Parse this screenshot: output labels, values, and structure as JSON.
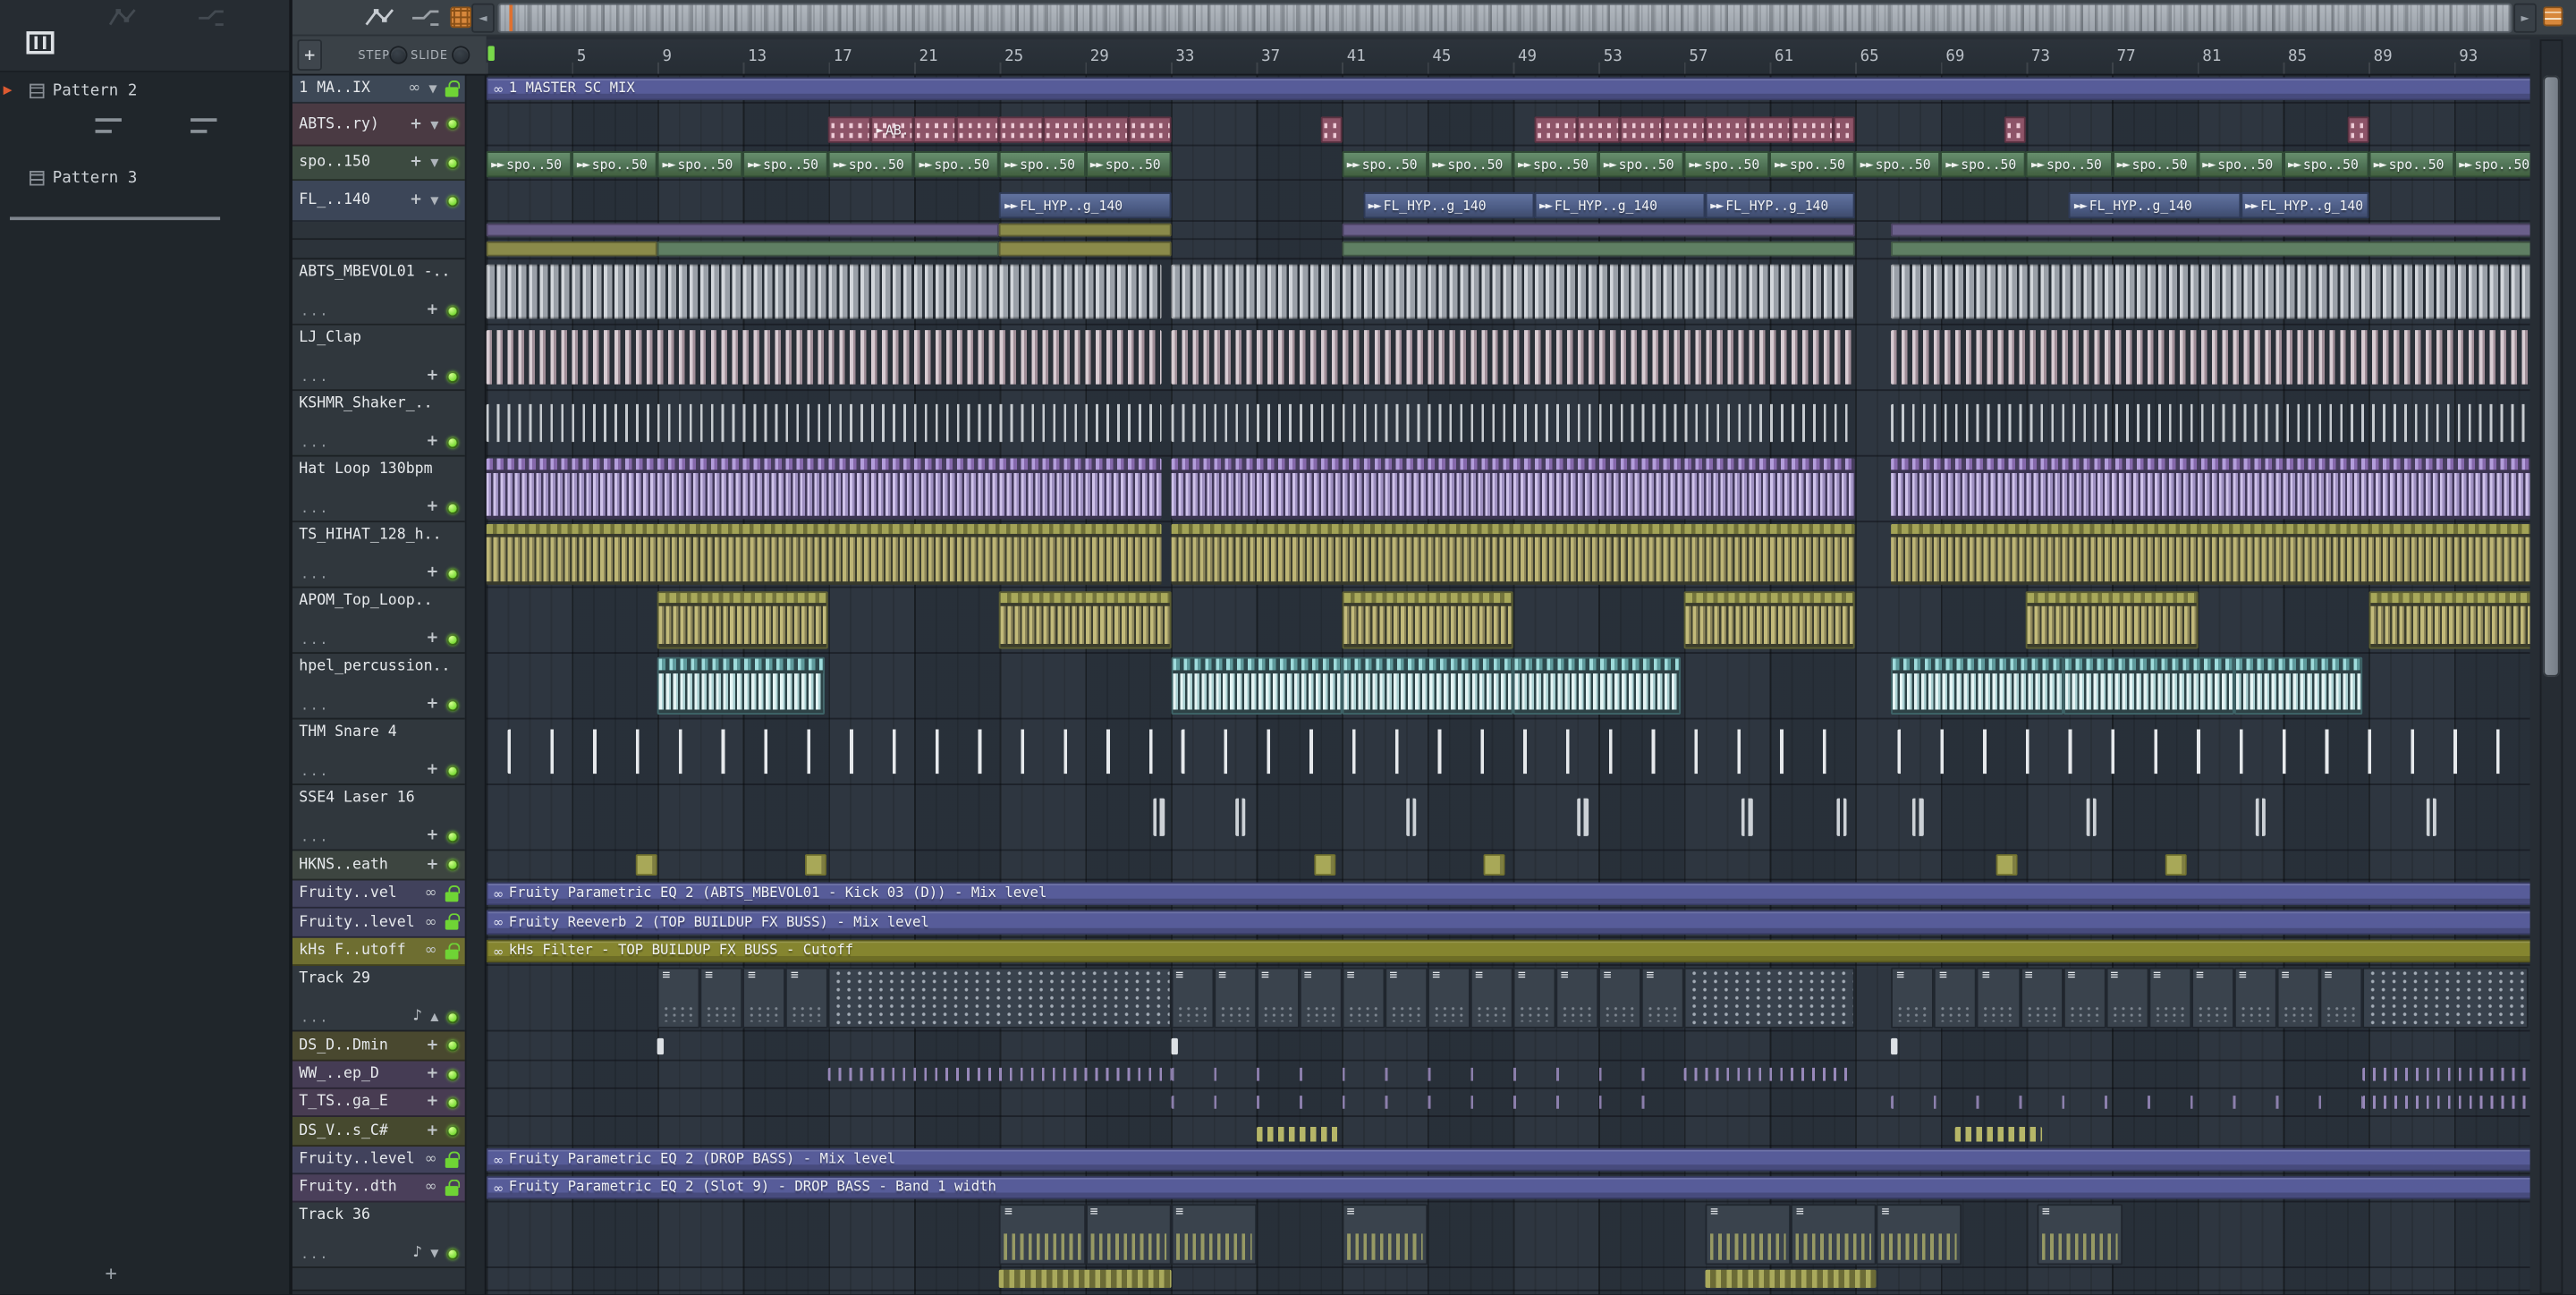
{
  "app": {
    "window": "FL Studio Playlist"
  },
  "colors": {
    "auto_purple": "#575c99",
    "auto_olive": "#85852f",
    "led_green": "#7edc3a",
    "lock_green": "#6fd435",
    "accent_orange": "#d8883c",
    "clip_pink": "#8d5468",
    "clip_green": "#5d8262",
    "clip_blue": "#5a6d99"
  },
  "picker": {
    "patterns": [
      {
        "label": "Pattern 2"
      },
      {
        "label": "Pattern 3"
      }
    ],
    "add_label": "+"
  },
  "toolbar": {
    "add_label": "+",
    "step_label": "STEP",
    "slide_label": "SLIDE"
  },
  "timeline": {
    "numbers": [
      5,
      9,
      13,
      17,
      21,
      25,
      29,
      33,
      37,
      41,
      45,
      49,
      53,
      57,
      61,
      65,
      69,
      73,
      77,
      81,
      85,
      89,
      93
    ]
  },
  "grid": {
    "bar_width": 13.02
  },
  "clip_labels": {
    "master": "1 MASTER SC MIX",
    "ab": "AB..)",
    "spo": "spo..50",
    "fl": "FL_HYP..g_140",
    "eq_kick": "Fruity Parametric EQ 2 (ABTS_MBEVOL01 - Kick 03 (D)) - Mix level",
    "reeverb": "Fruity Reeverb 2 (TOP BUILDUP FX BUSS) - Mix level",
    "khs": "kHs Filter - TOP BUILDUP FX BUSS - Cutoff",
    "eq_drop": "Fruity Parametric EQ 2 (DROP BASS) - Mix level",
    "eq_slot9": "Fruity Parametric EQ 2 (Slot 9) - DROP BASS - Band 1 width"
  },
  "tracks": [
    {
      "id": "master-mix",
      "name": "1 MA..IX",
      "h": 17,
      "tint": "#3d4856",
      "icons": [
        "link",
        "caret",
        "lock"
      ],
      "clips": [
        {
          "t": "auto",
          "b": 1,
          "len": 95.7,
          "label_ref": "master",
          "c": "auto_purple"
        }
      ]
    },
    {
      "id": "abts-pattern",
      "name": "ABTS..ry)",
      "h": 26,
      "tint": "#4a3a43",
      "icons": [
        "move",
        "caret",
        "led"
      ],
      "clips": [
        {
          "t": "pink",
          "bars": [
            17,
            21,
            23,
            25,
            27,
            29,
            31
          ],
          "len": 2
        },
        {
          "t": "pink",
          "b": 19,
          "len": 2,
          "label_ref": "ab"
        },
        {
          "t": "pink",
          "bars": [
            50,
            52,
            54,
            56,
            58,
            60,
            62
          ],
          "len": 2
        },
        {
          "t": "pink",
          "bars": [
            40,
            64,
            72,
            88
          ],
          "len": 1
        }
      ]
    },
    {
      "id": "spo-pattern",
      "name": "spo..150",
      "h": 21,
      "tint": "#3c4a40",
      "icons": [
        "move",
        "caret",
        "led"
      ],
      "clips": [
        {
          "t": "spo",
          "bars": [
            1,
            5,
            9,
            13,
            17,
            21,
            25,
            29,
            41,
            45,
            49,
            53,
            57,
            61,
            65,
            69,
            73,
            77,
            81,
            85,
            89,
            93
          ],
          "len": 4,
          "label_ref": "spo"
        }
      ]
    },
    {
      "id": "fl-hyp-pattern",
      "name": "FL_..140",
      "h": 25,
      "tint": "#3c4658",
      "icons": [
        "move",
        "caret",
        "led"
      ],
      "clips": [
        {
          "t": "fl",
          "b": 25,
          "len": 8,
          "label_ref": "fl"
        },
        {
          "t": "fl",
          "b": 42,
          "len": 8,
          "label_ref": "fl"
        },
        {
          "t": "fl",
          "b": 50,
          "len": 8,
          "label_ref": "fl"
        },
        {
          "t": "fl",
          "b": 58,
          "len": 7,
          "label_ref": "fl"
        },
        {
          "t": "fl",
          "b": 75,
          "len": 8,
          "label_ref": "fl"
        },
        {
          "t": "fl",
          "b": 83,
          "len": 6,
          "label_ref": "fl"
        }
      ]
    },
    {
      "id": "mini-track-1",
      "name": "",
      "h": 11,
      "tint": "#2c333a",
      "icons": [],
      "clips": [
        {
          "t": "seg",
          "b": 1,
          "len": 24,
          "c": "#6a5f8a"
        },
        {
          "t": "seg",
          "b": 25,
          "len": 8,
          "c": "#8a8a4a"
        },
        {
          "t": "seg",
          "b": 41,
          "len": 24,
          "c": "#6a5f8a"
        },
        {
          "t": "seg",
          "b": 66.7,
          "len": 30,
          "c": "#6a5f8a"
        }
      ]
    },
    {
      "id": "mini-track-2",
      "name": "",
      "h": 12,
      "tint": "#2c333a",
      "icons": [],
      "clips": [
        {
          "t": "seg",
          "b": 1,
          "len": 8,
          "c": "#8a8a4a"
        },
        {
          "t": "seg",
          "b": 9,
          "len": 16,
          "c": "#5f7f63"
        },
        {
          "t": "seg",
          "b": 25,
          "len": 8,
          "c": "#8a8a4a"
        },
        {
          "t": "seg",
          "b": 41,
          "len": 24,
          "c": "#5f7f63"
        },
        {
          "t": "seg",
          "b": 66.7,
          "len": 30,
          "c": "#5f7f63"
        }
      ]
    },
    {
      "id": "abts-mbevol01",
      "name": "ABTS_MBEVOL01 -..",
      "kind": "audio",
      "h": 40,
      "tint": "#30373d",
      "icons": [
        "move",
        "led"
      ],
      "clips": [
        {
          "t": "tex",
          "tex": "kick",
          "b": 1,
          "len": 31.6
        },
        {
          "t": "tex",
          "tex": "kick",
          "b": 33,
          "len": 32
        },
        {
          "t": "tex",
          "tex": "kick",
          "b": 66.7,
          "len": 29.9
        }
      ]
    },
    {
      "id": "lj-clap",
      "name": "LJ_Clap",
      "kind": "audio",
      "h": 40,
      "tint": "#30373d",
      "icons": [
        "move",
        "led"
      ],
      "clips": [
        {
          "t": "tex",
          "tex": "clap",
          "b": 1,
          "len": 31.6
        },
        {
          "t": "tex",
          "tex": "clap",
          "b": 33,
          "len": 32
        },
        {
          "t": "tex",
          "tex": "clap",
          "b": 66.7,
          "len": 29.9
        }
      ]
    },
    {
      "id": "kshmr-shaker",
      "name": "KSHMR_Shaker_..",
      "kind": "audio",
      "h": 40,
      "tint": "#30373d",
      "icons": [
        "move",
        "led"
      ],
      "clips": [
        {
          "t": "tex",
          "tex": "shaker",
          "b": 1,
          "len": 31.6
        },
        {
          "t": "tex",
          "tex": "shaker",
          "b": 33,
          "len": 32
        },
        {
          "t": "tex",
          "tex": "shaker",
          "b": 66.7,
          "len": 29.9
        }
      ]
    },
    {
      "id": "hat-loop-130bpm",
      "name": "Hat Loop 130bpm",
      "kind": "audio",
      "h": 40,
      "tint": "#30373d",
      "icons": [
        "move",
        "led"
      ],
      "clips": [
        {
          "t": "tex",
          "tex": "hat",
          "b": 1,
          "len": 31.6
        },
        {
          "t": "tex",
          "tex": "hat",
          "b": 33,
          "len": 32
        },
        {
          "t": "tex",
          "tex": "hat",
          "b": 66.7,
          "len": 29.9
        }
      ]
    },
    {
      "id": "ts-hihat-128",
      "name": "TS_HIHAT_128_h..",
      "kind": "audio",
      "h": 40,
      "tint": "#30373d",
      "icons": [
        "move",
        "led"
      ],
      "clips": [
        {
          "t": "tex",
          "tex": "tsh",
          "b": 1,
          "len": 31.6
        },
        {
          "t": "tex",
          "tex": "tsh",
          "b": 33,
          "len": 32
        },
        {
          "t": "tex",
          "tex": "tsh",
          "b": 66.7,
          "len": 29.9
        }
      ]
    },
    {
      "id": "apom-top-loop",
      "name": "APOM_Top_Loop..",
      "kind": "audio",
      "h": 40,
      "tint": "#30373d",
      "icons": [
        "move",
        "led"
      ],
      "clips": [
        {
          "t": "tex",
          "tex": "apom",
          "bars": [
            9,
            25,
            41,
            57,
            73
          ],
          "len": 8
        },
        {
          "t": "tex",
          "tex": "apom",
          "b": 89,
          "len": 7.6
        }
      ]
    },
    {
      "id": "hpel-percussion",
      "name": "hpel_percussion..",
      "kind": "audio",
      "h": 40,
      "tint": "#30373d",
      "icons": [
        "move",
        "led"
      ],
      "clips": [
        {
          "t": "tex",
          "tex": "hpel",
          "b": 9,
          "len": 7.8
        },
        {
          "t": "tex",
          "tex": "hpel",
          "bars": [
            33,
            41
          ],
          "len": 8
        },
        {
          "t": "tex",
          "tex": "hpel",
          "b": 49,
          "len": 7.8
        },
        {
          "t": "tex",
          "tex": "hpel",
          "bars": [
            66.7,
            74.7
          ],
          "len": 8
        },
        {
          "t": "tex",
          "tex": "hpel",
          "b": 82.7,
          "len": 6
        }
      ]
    },
    {
      "id": "thm-snare-4",
      "name": "THM Snare 4",
      "kind": "audio",
      "h": 40,
      "tint": "#30373d",
      "icons": [
        "move",
        "led"
      ],
      "clips": [
        {
          "t": "tex",
          "tex": "snare",
          "b": 2,
          "len": 30.6
        },
        {
          "t": "tex",
          "tex": "snare",
          "b": 33.5,
          "len": 31.2
        },
        {
          "t": "tex",
          "tex": "snare",
          "b": 67,
          "len": 29.5
        }
      ]
    },
    {
      "id": "sse4-laser-16",
      "name": "SSE4 Laser 16",
      "kind": "audio",
      "h": 40,
      "tint": "#30373d",
      "icons": [
        "move",
        "led"
      ],
      "clips": [
        {
          "t": "laser",
          "bars": [
            32.2,
            36,
            44,
            52,
            59.7,
            64.1,
            67.7,
            75.8,
            83.7,
            91.7
          ],
          "len": 0.5
        }
      ]
    },
    {
      "id": "hkns-breath",
      "name": "HKNS..eath",
      "h": 18,
      "tint": "#3d4540",
      "icons": [
        "move",
        "led"
      ],
      "clips": [
        {
          "t": "hkns",
          "bars": [
            8,
            15.9,
            39.7,
            47.6,
            71.6,
            79.5
          ],
          "len": 1
        }
      ]
    },
    {
      "id": "fruity-eq2-kick-lane",
      "name": "Fruity..vel",
      "h": 17,
      "tint": "#41425c",
      "icons": [
        "link",
        "lock"
      ],
      "clips": [
        {
          "t": "auto",
          "b": 1,
          "len": 95.7,
          "label_ref": "eq_kick",
          "c": "auto_purple"
        }
      ]
    },
    {
      "id": "fruity-reeverb-lane",
      "name": "Fruity..level",
      "h": 18,
      "tint": "#41425c",
      "icons": [
        "link",
        "lock"
      ],
      "clips": [
        {
          "t": "auto",
          "b": 1,
          "len": 95.7,
          "label_ref": "reeverb",
          "c": "auto_purple"
        }
      ]
    },
    {
      "id": "khs-filter-lane",
      "name": "kHs F..utoff",
      "h": 17,
      "tint": "#6e6e31",
      "icons": [
        "link",
        "lock"
      ],
      "clips": [
        {
          "t": "auto",
          "b": 1,
          "len": 95.7,
          "label_ref": "khs",
          "c": "auto_olive"
        }
      ]
    },
    {
      "id": "track-29",
      "name": "Track 29",
      "kind": "midi",
      "h": 40,
      "tint": "#31383f",
      "icons": [
        "note",
        "up",
        "led"
      ],
      "clips": [
        {
          "t": "midi",
          "bars": [
            9,
            11,
            13,
            15
          ],
          "len": 2
        },
        {
          "t": "dense",
          "b": 17,
          "len": 16
        },
        {
          "t": "midi",
          "bars": [
            33,
            35,
            37,
            39,
            41,
            43,
            45,
            47,
            49,
            51,
            53,
            55
          ],
          "len": 2
        },
        {
          "t": "dense",
          "b": 57,
          "len": 8
        },
        {
          "t": "midi",
          "bars": [
            66.7,
            68.7,
            70.7,
            72.7,
            74.7,
            76.7,
            78.7,
            80.7,
            82.7,
            84.7,
            86.7
          ],
          "len": 2
        },
        {
          "t": "dense",
          "b": 88.7,
          "len": 7.8
        }
      ]
    },
    {
      "id": "ds-d-dmin",
      "name": "DS_D..Dmin",
      "h": 18,
      "tint": "#49482f",
      "icons": [
        "move",
        "led"
      ],
      "clips": [
        {
          "t": "note",
          "bars": [
            9,
            33,
            66.7
          ],
          "len": 0.3
        }
      ]
    },
    {
      "id": "ww-ep-d",
      "name": "WW_..ep_D",
      "h": 17,
      "tint": "#453c54",
      "icons": [
        "move",
        "led"
      ],
      "clips": [
        {
          "t": "ldense",
          "b": 17,
          "len": 16
        },
        {
          "t": "ldense",
          "b": 57,
          "len": 8
        },
        {
          "t": "ldense",
          "b": 88.7,
          "len": 7.8
        },
        {
          "t": "lsparse",
          "b": 33,
          "len": 24
        }
      ]
    },
    {
      "id": "t-ts-ga-e",
      "name": "T_TS..ga_E",
      "h": 17,
      "tint": "#483c52",
      "icons": [
        "move",
        "led"
      ],
      "clips": [
        {
          "t": "lsparse",
          "b": 33,
          "len": 24
        },
        {
          "t": "lsparse",
          "b": 66.7,
          "len": 22
        },
        {
          "t": "ldense",
          "b": 88.7,
          "len": 7.8
        }
      ]
    },
    {
      "id": "ds-v-csharp",
      "name": "DS_V..s_C#",
      "h": 18,
      "tint": "#46492e",
      "icons": [
        "move",
        "led"
      ],
      "clips": [
        {
          "t": "run",
          "bars": [
            37,
            69.7
          ],
          "len": 4
        }
      ]
    },
    {
      "id": "fruity-eq2-drop-lane",
      "name": "Fruity..level",
      "h": 17,
      "tint": "#41425c",
      "icons": [
        "link",
        "lock"
      ],
      "clips": [
        {
          "t": "auto",
          "b": 1,
          "len": 95.7,
          "label_ref": "eq_drop",
          "c": "auto_purple"
        }
      ]
    },
    {
      "id": "fruity-eq2-slot9-lane",
      "name": "Fruity..dth",
      "h": 17,
      "tint": "#4a3f5a",
      "icons": [
        "link",
        "lock"
      ],
      "clips": [
        {
          "t": "auto",
          "b": 1,
          "len": 95.7,
          "label_ref": "eq_slot9",
          "c": "auto_purple"
        }
      ]
    },
    {
      "id": "track-36",
      "name": "Track 36",
      "kind": "midi",
      "h": 40,
      "tint": "#31383f",
      "icons": [
        "note",
        "caret",
        "led"
      ],
      "clips": [
        {
          "t": "midi36",
          "bars": [
            25,
            29,
            33,
            41,
            58,
            62,
            66,
            73.5
          ],
          "len": 4
        }
      ]
    },
    {
      "id": "partial-row",
      "name": "",
      "h": 14,
      "tint": "#2c333a",
      "icons": [],
      "clips": [
        {
          "t": "runfull",
          "bars": [
            25,
            58
          ],
          "len": 8
        }
      ]
    }
  ]
}
